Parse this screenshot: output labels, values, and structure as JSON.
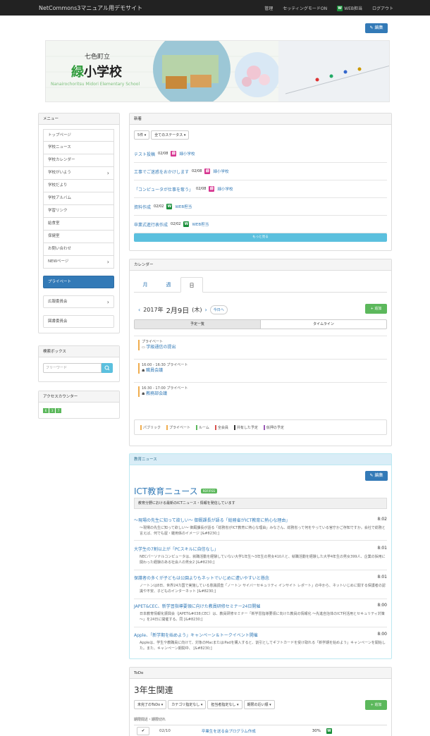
{
  "topbar": {
    "brand": "NetCommons3マニュアル用デモサイト",
    "nav": [
      "管理",
      "セッティングモードON"
    ],
    "user_badge": "W",
    "user_name": "WEB担当",
    "logout": "ログアウト"
  },
  "header": {
    "edit_label": "編集",
    "school_small": "七色町立",
    "school_green": "緑",
    "school_rest": "小学校",
    "school_en": "Nanairochoritsu Midori Elementary School"
  },
  "menu": {
    "title": "メニュー",
    "items": [
      {
        "label": "トップページ",
        "chev": ""
      },
      {
        "label": "学校ニュース",
        "chev": ""
      },
      {
        "label": "学校カレンダー",
        "chev": ""
      },
      {
        "label": "学校がいよう",
        "chev": "›"
      },
      {
        "label": "学校だより",
        "chev": ""
      },
      {
        "label": "学校アルバム",
        "chev": ""
      },
      {
        "label": "学習リンク",
        "chev": ""
      },
      {
        "label": "給食室",
        "chev": ""
      },
      {
        "label": "保健室",
        "chev": ""
      },
      {
        "label": "お問い合わせ",
        "chev": ""
      },
      {
        "label": "NEWページ",
        "chev": "›"
      }
    ],
    "private": "プライベート",
    "kouhou": "広報委員会",
    "kouhou_chev": "›",
    "tosho": "図書委員会"
  },
  "search": {
    "title": "検索ボックス",
    "placeholder": "フリーワード"
  },
  "counter": {
    "title": "アクセスカウンター",
    "digits": [
      "6",
      "3",
      "7"
    ]
  },
  "newarrivals": {
    "title": "新着",
    "count_label": "5件",
    "status_label": "全てのステータス",
    "items": [
      {
        "title": "テスト投稿",
        "date": "02/08",
        "badge": "緑",
        "user": "緑小学校"
      },
      {
        "title": "工事でご迷惑をおかけします",
        "date": "02/08",
        "badge": "緑",
        "user": "緑小学校"
      },
      {
        "title": "「コンピュータが仕事を奪う」",
        "date": "02/08",
        "badge": "緑",
        "user": "緑小学校"
      },
      {
        "title": "資料作成",
        "date": "02/02",
        "badge": "W",
        "user": "WEB担当"
      },
      {
        "title": "卒業式進行表作成",
        "date": "02/02",
        "badge": "W",
        "user": "WEB担当"
      }
    ],
    "more": "もっと見る"
  },
  "calendar": {
    "title": "カレンダー",
    "tabs": [
      "月",
      "週",
      "日"
    ],
    "year": "2017年",
    "date": "2月9日",
    "weekday": "(木)",
    "today": "今日へ",
    "add": "+ 追加",
    "view_list": "予定一覧",
    "view_timeline": "タイムライン",
    "events": [
      {
        "meta": "プライベート",
        "title": "学級通信の提出"
      },
      {
        "meta": "16:00 - 16:30 プライベート",
        "title": "職員会議"
      },
      {
        "meta": "16:30 - 17:00 プライベート",
        "title": "教務部会議"
      }
    ],
    "legend": [
      "パブリック",
      "プライベート",
      "ルーム",
      "全会員",
      "共有した予定",
      "仮押の予定"
    ]
  },
  "rss": {
    "panel_title": "教育ニュース",
    "edit": "編集",
    "title": "ICT教育ニュース",
    "badge": "RDF/RSS",
    "summary": "教育分野における最新のICTニュース・情報を発信しています",
    "items": [
      {
        "title": "～現場の先生に知って欲しい～ 御厩課長が語る「総務省がICT教育に熱心な理由」",
        "time": "8:02",
        "desc": "～現場の先生に知って欲しい～ 御厩課長が語る「総務省がICT教育に熱心な理由」みなさん、総務省って何をやっている官庁かご存知ですか。会社で総務と言えば、何でも屋・雑用係のイメージ [&#8230;]"
      },
      {
        "title": "大学生の7割以上が「PCスキルに自信なし」",
        "time": "8:01",
        "desc": "NECパーソナルコンピュータは、就職活動を経験していない大学1年生～3年生の男女410人と、就職活動を経験した大学4年生の男女399人、企業の採用に関わった経験のある社会人の男女2 [&#8230;]"
      },
      {
        "title": "保護者の多くが子どもは公園よりもネットでいじめに遭いやすいと懸念",
        "time": "8:01",
        "desc": "ノートンは8日、世界24カ国で実施している意識調査「ノートン サイバーセキュリティ インサイト レポート」の中から、ネットいじめに関する保護者の認識や不安、子どものインターネット [&#8230;]"
      },
      {
        "title": "JAPET&CEC、新学習指導要領に向けた教員研修セミナー24日開催",
        "time": "8:00",
        "desc": "日本教育情報化振興会（JAPET&#038;CEC）は、教員研修セミナー「新学習指導要領に向けた教員の情報化 ～先進自治体のICT利活用とセキュリティ対策～」を24日に開催する。同 [&#8230;]"
      },
      {
        "title": "Apple、「新学期を始めよう」キャンペーン＆トークイベント開催",
        "time": "8:00",
        "desc": "Appleは、学生や教職員に向けて、対象のMacまたはiPadを購入すると、割引としてギフトカードを受け取れる「新学期を始めよう」キャンペーンを開始した。また、キャンペーン期間中、 [&#8230;]"
      }
    ]
  },
  "todo": {
    "panel_title": "ToDo",
    "title": "3年生関連",
    "filters": [
      "未完了のToDo",
      "カテゴリ指定なし",
      "担当者指定なし",
      "期限の近い順"
    ],
    "add": "+ 追加",
    "section": "期限間近・期限切れ",
    "rows": [
      {
        "date": "02/10",
        "title": "卒業生を送る会プログラム作成",
        "percent": "30%",
        "badge": "W"
      }
    ]
  }
}
